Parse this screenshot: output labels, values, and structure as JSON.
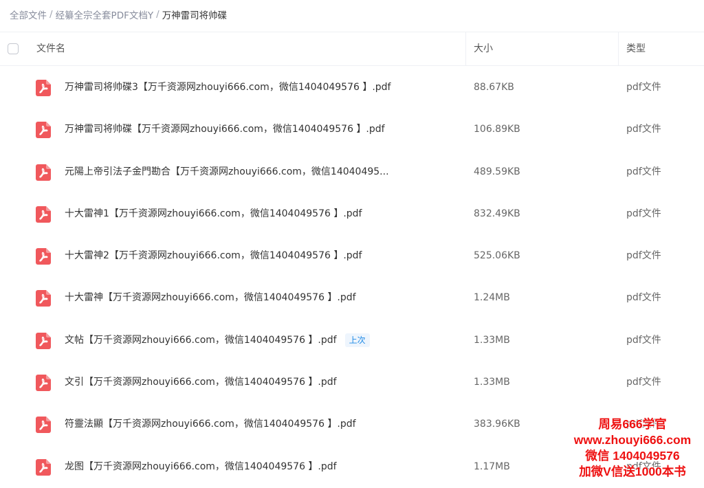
{
  "breadcrumb": {
    "items": [
      "全部文件",
      "经纂全宗全套PDF文档Y"
    ],
    "current": "万神雷司将帅碟",
    "separator": "/"
  },
  "table": {
    "columns": {
      "name": "文件名",
      "size": "大小",
      "type": "类型"
    },
    "rows": [
      {
        "name": "万神雷司将帅碟3【万千资源网zhouyi666.com，微信1404049576 】.pdf",
        "size": "88.67KB",
        "type": "pdf文件",
        "icon": "pdf-icon"
      },
      {
        "name": "万神雷司将帅碟【万千资源网zhouyi666.com，微信1404049576 】.pdf",
        "size": "106.89KB",
        "type": "pdf文件",
        "icon": "pdf-icon"
      },
      {
        "name": "元陽上帝引法子金門勘合【万千资源网zhouyi666.com，微信14040495...",
        "size": "489.59KB",
        "type": "pdf文件",
        "icon": "pdf-icon"
      },
      {
        "name": "十大雷神1【万千资源网zhouyi666.com，微信1404049576 】.pdf",
        "size": "832.49KB",
        "type": "pdf文件",
        "icon": "pdf-icon"
      },
      {
        "name": "十大雷神2【万千资源网zhouyi666.com，微信1404049576 】.pdf",
        "size": "525.06KB",
        "type": "pdf文件",
        "icon": "pdf-icon"
      },
      {
        "name": "十大雷神【万千资源网zhouyi666.com，微信1404049576 】.pdf",
        "size": "1.24MB",
        "type": "pdf文件",
        "icon": "pdf-icon"
      },
      {
        "name": "文帖【万千资源网zhouyi666.com，微信1404049576 】.pdf",
        "size": "1.33MB",
        "type": "pdf文件",
        "icon": "pdf-icon",
        "badge": "上次"
      },
      {
        "name": "文引【万千资源网zhouyi666.com，微信1404049576 】.pdf",
        "size": "1.33MB",
        "type": "pdf文件",
        "icon": "pdf-icon"
      },
      {
        "name": "符靈法顯【万千资源网zhouyi666.com，微信1404049576 】.pdf",
        "size": "383.96KB",
        "type": "pdf文件",
        "icon": "pdf-icon"
      },
      {
        "name": "龙图【万千资源网zhouyi666.com，微信1404049576 】.pdf",
        "size": "1.17MB",
        "type": "pdf文件",
        "icon": "pdf-icon"
      }
    ]
  },
  "watermark": {
    "lines": [
      "周易666学官",
      "www.zhouyi666.com",
      "微信 1404049576",
      "加微V信送1000本书"
    ]
  },
  "colors": {
    "pdf_icon": "#f0585c",
    "badge_text": "#1f8ae6",
    "watermark": "#ee1111"
  }
}
